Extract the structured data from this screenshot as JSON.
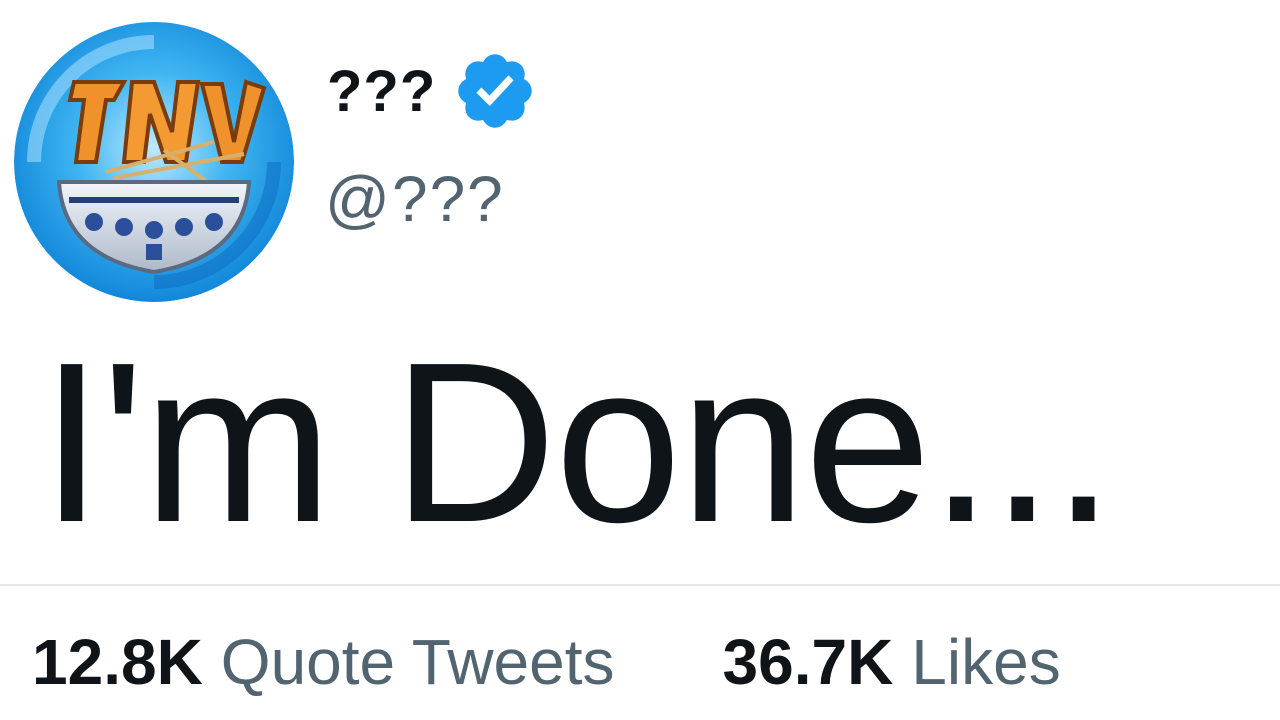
{
  "tweet": {
    "author": {
      "display_name": "???",
      "handle": "@???",
      "verified": true,
      "verified_icon": "verified-badge-icon",
      "avatar_text": "TN"
    },
    "text": "I'm Done...",
    "stats": [
      {
        "count": "12.8K",
        "label": "Quote Tweets"
      },
      {
        "count": "36.7K",
        "label": "Likes"
      }
    ]
  },
  "colors": {
    "primary_text": "#0f1419",
    "secondary_text": "#536471",
    "verified_blue": "#1d9bf0",
    "divider": "#e4e8ec"
  }
}
